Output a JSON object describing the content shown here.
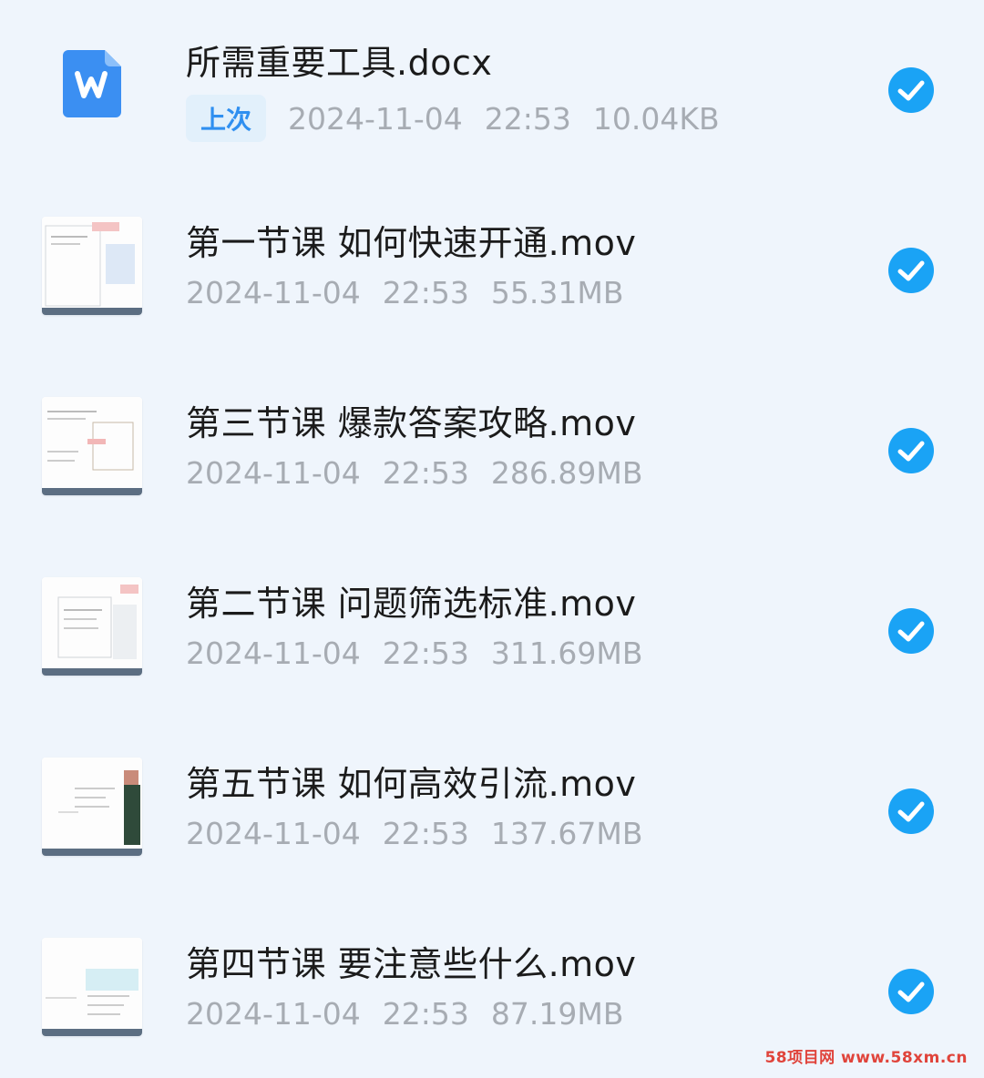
{
  "files": [
    {
      "name": "所需重要工具.docx",
      "badge": "上次",
      "date": "2024-11-04",
      "time": "22:53",
      "size": "10.04KB",
      "icon": "word-doc-icon",
      "selected": true
    },
    {
      "name": "第一节课 如何快速开通.mov",
      "date": "2024-11-04",
      "time": "22:53",
      "size": "55.31MB",
      "icon": "video-thumbnail",
      "selected": true
    },
    {
      "name": "第三节课 爆款答案攻略.mov",
      "date": "2024-11-04",
      "time": "22:53",
      "size": "286.89MB",
      "icon": "video-thumbnail",
      "selected": true
    },
    {
      "name": "第二节课 问题筛选标准.mov",
      "date": "2024-11-04",
      "time": "22:53",
      "size": "311.69MB",
      "icon": "video-thumbnail",
      "selected": true
    },
    {
      "name": "第五节课 如何高效引流.mov",
      "date": "2024-11-04",
      "time": "22:53",
      "size": "137.67MB",
      "icon": "video-thumbnail",
      "selected": true
    },
    {
      "name": "第四节课 要注意些什么.mov",
      "date": "2024-11-04",
      "time": "22:53",
      "size": "87.19MB",
      "icon": "video-thumbnail",
      "selected": true
    }
  ],
  "watermark": "58项目网 www.58xm.cn",
  "colors": {
    "accent": "#1aa3f5",
    "background": "#eff5fc",
    "word_icon": "#3b8ff2",
    "badge_text": "#2f8ff0"
  }
}
